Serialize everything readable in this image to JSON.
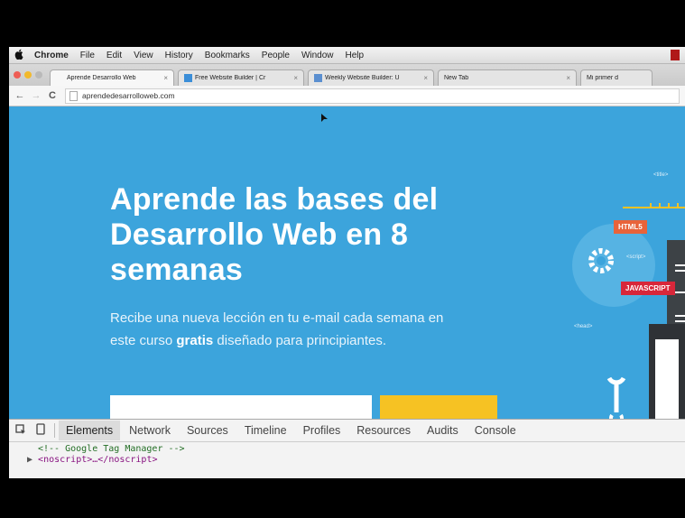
{
  "menubar": {
    "app": "Chrome",
    "items": [
      "File",
      "Edit",
      "View",
      "History",
      "Bookmarks",
      "People",
      "Window",
      "Help"
    ]
  },
  "tabs": [
    {
      "label": "Aprende Desarrollo Web",
      "close": "×",
      "favicon_color": "#ffffff"
    },
    {
      "label": "Free Website Builder | Cr",
      "close": "×",
      "favicon_color": "#3b8ed8"
    },
    {
      "label": "Weekly Website Builder: U",
      "close": "×",
      "favicon_color": "#5b8fd0"
    },
    {
      "label": "New Tab",
      "close": "×",
      "favicon_color": "#ffffff"
    },
    {
      "label": "Mi primer d",
      "close": "",
      "favicon_color": "#ffffff"
    }
  ],
  "toolbar": {
    "back": "←",
    "forward": "→",
    "reload": "C",
    "url": "aprendedesarrolloweb.com"
  },
  "hero": {
    "headline_lines": [
      "Aprende las bases del",
      "Desarrollo Web en 8",
      "semanas"
    ],
    "sub_1": "Recibe una nueva lección en tu e-mail cada semana en",
    "sub_2_before": "este curso ",
    "sub_2_bold": "gratis",
    "sub_2_after": " diseñado para principiantes."
  },
  "illustration": {
    "tag_title": "<title>",
    "tag_html": "HTML5",
    "tag_script": "<script>",
    "tag_js": "JAVASCRIPT",
    "tag_head": "<head>"
  },
  "devtools": {
    "tabs": [
      "Elements",
      "Network",
      "Sources",
      "Timeline",
      "Profiles",
      "Resources",
      "Audits",
      "Console"
    ],
    "active_tab": "Elements",
    "code_comment": "<!-- Google Tag Manager -->",
    "code_noscript": "<noscript>…</noscript>"
  },
  "colors": {
    "page_bg": "#3ca4dc",
    "cta": "#f6c223",
    "html5_label": "#e8633a",
    "js_label": "#d8273a"
  }
}
